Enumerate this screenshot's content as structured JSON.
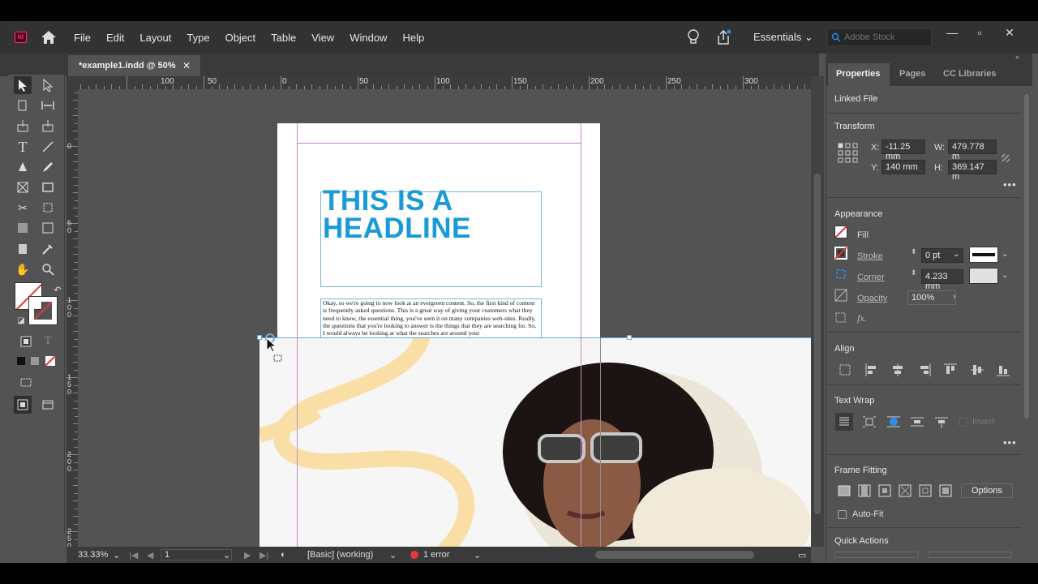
{
  "menubar": {
    "app_icon": "Id",
    "items": [
      "File",
      "Edit",
      "Layout",
      "Type",
      "Object",
      "Table",
      "View",
      "Window",
      "Help"
    ],
    "workspace": "Essentials",
    "stock_placeholder": "Adobe Stock"
  },
  "document": {
    "tab_title": "*example1.indd @ 50%",
    "headline_line1": "THIS IS A",
    "headline_line2": "HEADLINE",
    "body_text": "Okay, so we're going to now look at an evergreen content. So, the first kind of content is frequently asked questions. This is a great way of giving your customers what they need to know, the essential thing, you've seen it on many companies web-sites. Really, the questions that you're looking to answer is the things that they are searching for. So, I would always be looking at what the searches are around your"
  },
  "ruler": {
    "top_labels": [
      "100",
      "50",
      "0",
      "50",
      "100",
      "150",
      "200",
      "250",
      "300"
    ],
    "left_labels": [
      "0",
      "50",
      "100",
      "150",
      "200",
      "250"
    ]
  },
  "statusbar": {
    "zoom": "33.33%",
    "page": "1",
    "preflight_profile": "[Basic] (working)",
    "errors": "1 error"
  },
  "panel": {
    "tabs": [
      "Properties",
      "Pages",
      "CC Libraries"
    ],
    "linked_file": "Linked File",
    "transform": {
      "title": "Transform",
      "x_label": "X:",
      "x": "-11.25 mm",
      "y_label": "Y:",
      "y": "140 mm",
      "w_label": "W:",
      "w": "479.778 m",
      "h_label": "H:",
      "h": "369.147 m"
    },
    "appearance": {
      "title": "Appearance",
      "fill": "Fill",
      "stroke": "Stroke",
      "stroke_value": "0 pt",
      "corner": "Corner",
      "corner_value": "4.233 mm",
      "opacity": "Opacity",
      "opacity_value": "100%"
    },
    "align_title": "Align",
    "text_wrap_title": "Text Wrap",
    "invert": "Invert",
    "frame_fitting_title": "Frame Fitting",
    "options": "Options",
    "auto_fit": "Auto-Fit",
    "quick_actions": "Quick Actions"
  },
  "colors": {
    "accent_blue": "#1a9ad6",
    "error_red": "#e03a3a",
    "app_pink": "#ff3366"
  }
}
